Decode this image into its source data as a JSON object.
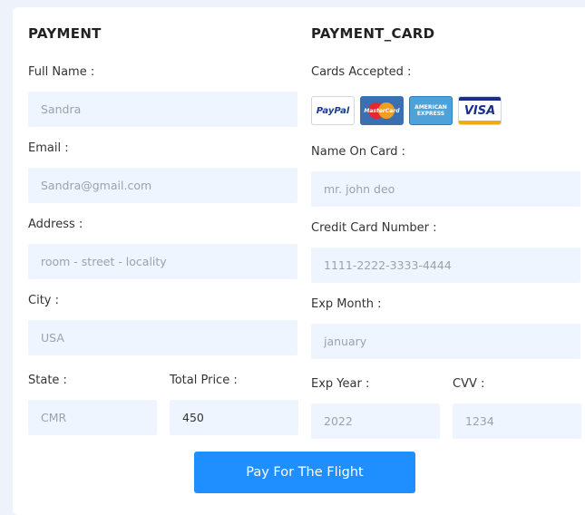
{
  "payment": {
    "title": "PAYMENT",
    "full_name": {
      "label": "Full Name :",
      "value": "Sandra"
    },
    "email": {
      "label": "Email :",
      "value": "Sandra@gmail.com"
    },
    "address": {
      "label": "Address :",
      "value": "room - street - locality"
    },
    "city": {
      "label": "City :",
      "value": "USA"
    },
    "state": {
      "label": "State :",
      "value": "CMR"
    },
    "total_price": {
      "label": "Total Price :",
      "value": "450"
    }
  },
  "payment_card": {
    "title": "PAYMENT_CARD",
    "cards_accepted_label": "Cards Accepted :",
    "cards": [
      {
        "name": "paypal",
        "text": "PayPal"
      },
      {
        "name": "mastercard",
        "text": "MasterCard"
      },
      {
        "name": "american-express",
        "text": "AMERICAN EXPRESS"
      },
      {
        "name": "visa",
        "text": "VISA"
      }
    ],
    "name_on_card": {
      "label": "Name On Card :",
      "value": "mr. john deo"
    },
    "card_number": {
      "label": "Credit Card Number :",
      "value": "1111-2222-3333-4444"
    },
    "exp_month": {
      "label": "Exp Month :",
      "value": "january"
    },
    "exp_year": {
      "label": "Exp Year :",
      "value": "2022"
    },
    "cvv": {
      "label": "CVV :",
      "value": "1234"
    }
  },
  "submit_label": "Pay For The Flight",
  "colors": {
    "accent": "#1f8fff",
    "field_bg": "#eef5fe",
    "page_bg": "#eef3fb"
  }
}
